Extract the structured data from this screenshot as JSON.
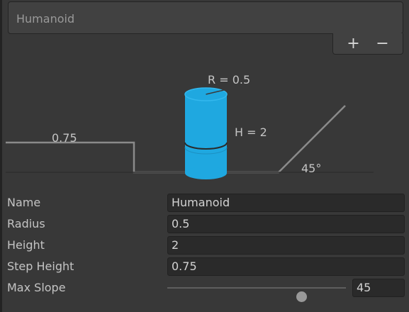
{
  "agent_list": {
    "items": [
      "Humanoid"
    ],
    "add_label": "+",
    "remove_label": "−"
  },
  "diagram": {
    "radius_label": "R = 0.5",
    "height_label": "H = 2",
    "step_label": "0.75",
    "slope_label": "45°"
  },
  "properties": {
    "name": {
      "label": "Name",
      "value": "Humanoid"
    },
    "radius": {
      "label": "Radius",
      "value": "0.5"
    },
    "height": {
      "label": "Height",
      "value": "2"
    },
    "step_height": {
      "label": "Step Height",
      "value": "0.75"
    },
    "max_slope": {
      "label": "Max Slope",
      "value": "45",
      "slider_fraction": 0.75
    }
  },
  "colors": {
    "cylinder": "#1fa8e0",
    "cylinder_top": "#4ac3f2",
    "background": "#383838",
    "field": "#2a2a2a"
  }
}
